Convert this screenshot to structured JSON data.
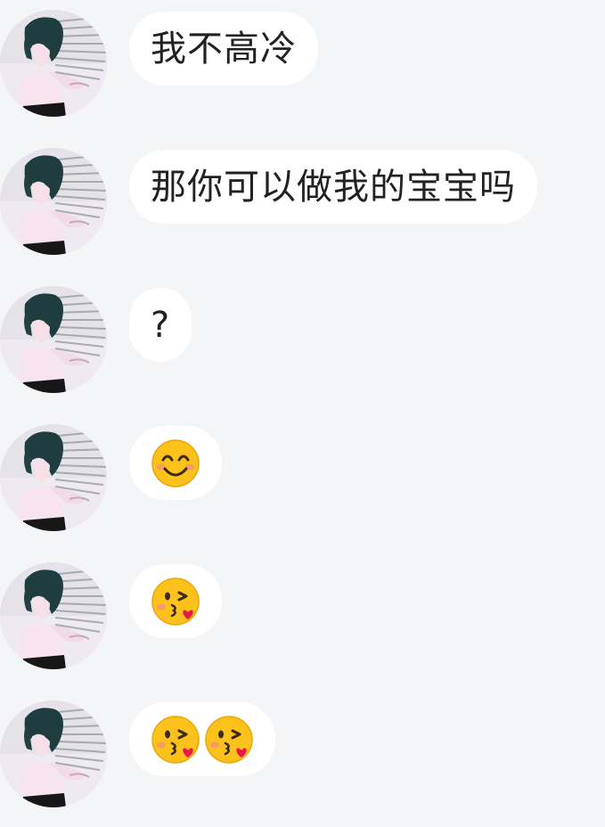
{
  "messages": [
    {
      "type": "text",
      "text": "我不高冷"
    },
    {
      "type": "text",
      "text": "那你可以做我的宝宝吗"
    },
    {
      "type": "text",
      "text": "?"
    },
    {
      "type": "emoji",
      "emojis": [
        "smiling-face-with-smiling-eyes"
      ]
    },
    {
      "type": "emoji",
      "emojis": [
        "face-blowing-kiss"
      ]
    },
    {
      "type": "emoji",
      "emojis": [
        "face-blowing-kiss",
        "face-blowing-kiss"
      ]
    }
  ],
  "colors": {
    "background": "#f4f5f7",
    "bubble": "#ffffff",
    "text": "#222222"
  }
}
